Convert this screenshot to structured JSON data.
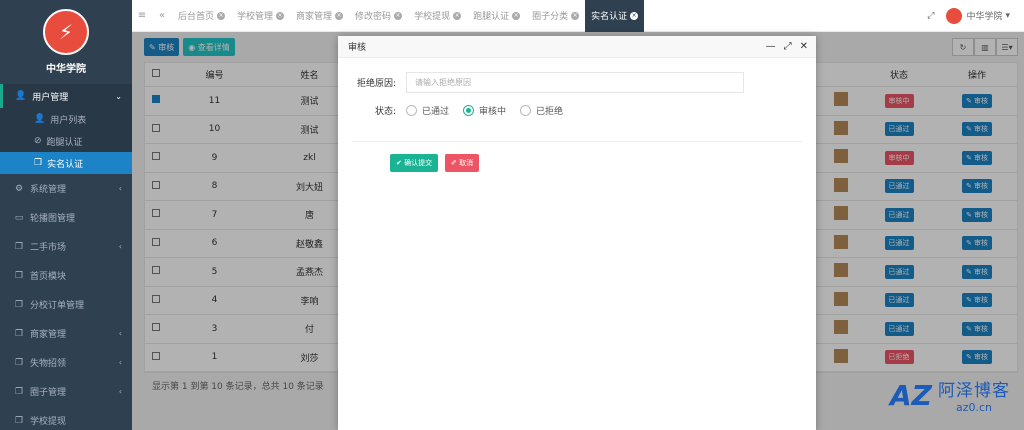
{
  "sidebar": {
    "school_name": "中华学院",
    "group": {
      "label": "用户管理",
      "items": [
        {
          "label": "用户列表",
          "icon": "user-icon"
        },
        {
          "label": "跑腿认证",
          "icon": "check-circle-icon"
        },
        {
          "label": "实名认证",
          "icon": "copy-icon"
        }
      ]
    },
    "items": [
      {
        "label": "系统管理",
        "icon": "gears-icon",
        "has_children": true
      },
      {
        "label": "轮播图管理",
        "icon": "monitor-icon",
        "has_children": false
      },
      {
        "label": "二手市场",
        "icon": "copy-icon",
        "has_children": true
      },
      {
        "label": "首页模块",
        "icon": "copy-icon",
        "has_children": false
      },
      {
        "label": "分校订单管理",
        "icon": "copy-icon",
        "has_children": false
      },
      {
        "label": "商家管理",
        "icon": "copy-icon",
        "has_children": true
      },
      {
        "label": "失物招领",
        "icon": "copy-icon",
        "has_children": true
      },
      {
        "label": "圈子管理",
        "icon": "copy-icon",
        "has_children": true
      },
      {
        "label": "学校提现",
        "icon": "copy-icon",
        "has_children": false
      }
    ]
  },
  "topbar": {
    "tabs": [
      {
        "label": "后台首页",
        "active": false
      },
      {
        "label": "学校管理",
        "active": false
      },
      {
        "label": "商家管理",
        "active": false
      },
      {
        "label": "修改密码",
        "active": false
      },
      {
        "label": "学校提现",
        "active": false
      },
      {
        "label": "跑腿认证",
        "active": false
      },
      {
        "label": "圈子分类",
        "active": false
      },
      {
        "label": "实名认证",
        "active": true
      }
    ],
    "user": "中华学院"
  },
  "toolbar": {
    "review_label": "审核",
    "detail_label": "查看详情"
  },
  "table": {
    "headers": {
      "num": "编号",
      "name": "姓名",
      "state": "状态",
      "op": "操作"
    },
    "rows": [
      {
        "id": "11",
        "name": "测试",
        "state": "审核中",
        "state_color": "red",
        "checked": true,
        "op": "审核"
      },
      {
        "id": "10",
        "name": "测试",
        "state": "已通过",
        "state_color": "blue",
        "checked": false,
        "op": "审核"
      },
      {
        "id": "9",
        "name": "zkl",
        "state": "审核中",
        "state_color": "red",
        "checked": false,
        "op": "审核"
      },
      {
        "id": "8",
        "name": "刘大妞",
        "state": "已通过",
        "state_color": "blue",
        "checked": false,
        "op": "审核"
      },
      {
        "id": "7",
        "name": "唐",
        "state": "已通过",
        "state_color": "blue",
        "checked": false,
        "op": "审核"
      },
      {
        "id": "6",
        "name": "赵敬鑫",
        "state": "已通过",
        "state_color": "blue",
        "checked": false,
        "op": "审核"
      },
      {
        "id": "5",
        "name": "孟燕杰",
        "state": "已通过",
        "state_color": "blue",
        "checked": false,
        "op": "审核"
      },
      {
        "id": "4",
        "name": "李响",
        "state": "已通过",
        "state_color": "blue",
        "checked": false,
        "op": "审核"
      },
      {
        "id": "3",
        "name": "付",
        "state": "已通过",
        "state_color": "blue",
        "checked": false,
        "op": "审核"
      },
      {
        "id": "1",
        "name": "刘莎",
        "state": "已拒绝",
        "state_color": "red",
        "checked": false,
        "op": "审核"
      }
    ],
    "footer": "显示第 1 到第 10 条记录，总共 10 条记录"
  },
  "modal": {
    "title": "审核",
    "reason_label": "拒绝原因:",
    "reason_placeholder": "请输入拒绝原因",
    "status_label": "状态:",
    "options": [
      {
        "label": "已通过",
        "selected": false
      },
      {
        "label": "审核中",
        "selected": true
      },
      {
        "label": "已拒绝",
        "selected": false
      }
    ],
    "confirm_label": "确认提交",
    "cancel_label": "取消"
  },
  "watermark": {
    "main": "阿泽博客",
    "sub": "az0.cn",
    "logo": "AZ"
  },
  "colors": {
    "sidebar": "#2f4050",
    "primary": "#1c84c6",
    "success": "#1ab394",
    "danger": "#ed5565"
  }
}
